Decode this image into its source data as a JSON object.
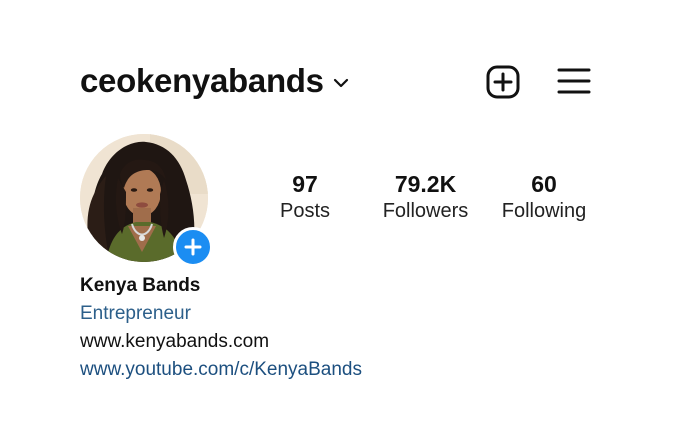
{
  "header": {
    "username": "ceokenyabands",
    "dropdown_icon": "chevron-down-icon",
    "create_icon": "plus-square-icon",
    "menu_icon": "hamburger-menu-icon"
  },
  "profile": {
    "avatar_icon": "profile-photo",
    "add_story_icon": "plus-icon",
    "accent_color": "#1b8df2"
  },
  "stats": {
    "posts": {
      "value": "97",
      "label": "Posts"
    },
    "followers": {
      "value": "79.2K",
      "label": "Followers"
    },
    "following": {
      "value": "60",
      "label": "Following"
    }
  },
  "bio": {
    "name": "Kenya Bands",
    "category": "Entrepreneur",
    "website_text": "www.kenyabands.com",
    "link": "www.youtube.com/c/KenyaBands"
  }
}
